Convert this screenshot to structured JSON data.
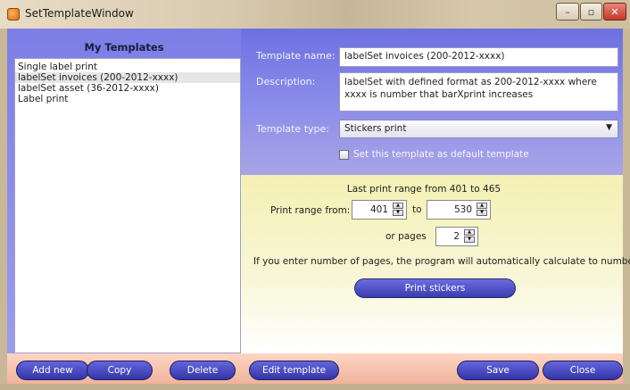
{
  "window": {
    "title": "SetTemplateWindow",
    "controls": {
      "minimize": "–",
      "maximize": "▫",
      "close": "✕"
    }
  },
  "templates": {
    "header": "My Templates",
    "items": [
      {
        "label": "Single label print",
        "selected": false
      },
      {
        "label": "labelSet invoices (200-2012-xxxx)",
        "selected": true
      },
      {
        "label": "labelSet asset (36-2012-xxxx)",
        "selected": false
      },
      {
        "label": "Label print",
        "selected": false
      }
    ]
  },
  "form": {
    "name_label": "Template name:",
    "name_value": "labelSet invoices (200-2012-xxxx)",
    "description_label": "Description:",
    "description_value": "labelSet with defined format as 200-2012-xxxx where xxxx is number that barXprint increases",
    "type_label": "Template type:",
    "type_value": "Stickers print",
    "default_checkbox_label": "Set this template as default template",
    "default_checked": false
  },
  "print": {
    "last_range": "Last print range from 401 to 465",
    "range_from_label": "Print range from:",
    "from_value": "401",
    "to_label": "to",
    "to_value": "530",
    "or_pages_label": "or pages",
    "pages_value": "2",
    "hint": "If you enter number of pages, the program will automatically calculate to number",
    "print_button": "Print stickers"
  },
  "footer": {
    "add_new": "Add new",
    "copy": "Copy",
    "delete": "Delete",
    "edit_template": "Edit template",
    "save": "Save",
    "close": "Close"
  },
  "colors": {
    "accent": "#4a4bc4",
    "header_panel": "#7d7ee6",
    "print_panel": "#f4f0b4",
    "footer": "#f0b49c"
  }
}
